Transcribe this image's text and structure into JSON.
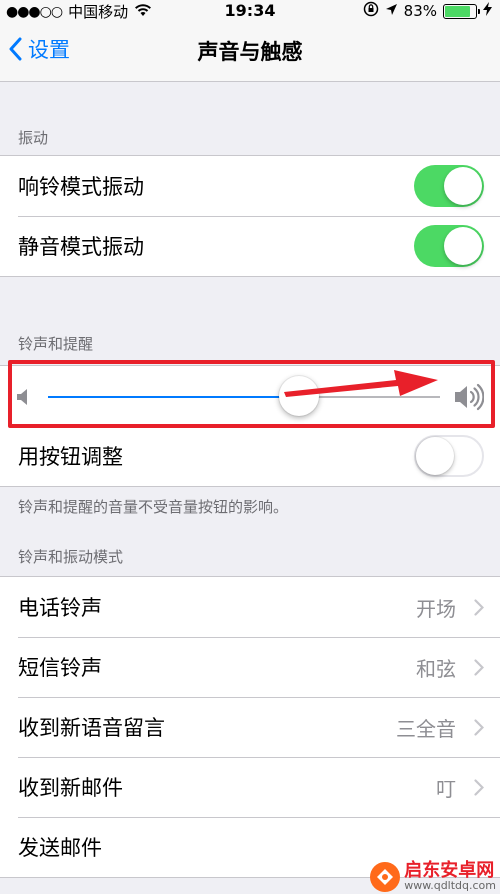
{
  "status_bar": {
    "signal": "●●●○○",
    "carrier": "中国移动",
    "time": "19:34",
    "battery_percent": "83%",
    "battery_level": 0.83
  },
  "nav": {
    "back_label": "设置",
    "title": "声音与触感"
  },
  "vibration": {
    "header": "振动",
    "rows": [
      {
        "label": "响铃模式振动",
        "on": true
      },
      {
        "label": "静音模式振动",
        "on": true
      }
    ]
  },
  "ringer": {
    "header": "铃声和提醒",
    "volume_level": 0.64,
    "button_adjust_label": "用按钮调整",
    "button_adjust_on": false,
    "footer": "铃声和提醒的音量不受音量按钮的影响。"
  },
  "patterns": {
    "header": "铃声和振动模式",
    "rows": [
      {
        "label": "电话铃声",
        "value": "开场"
      },
      {
        "label": "短信铃声",
        "value": "和弦"
      },
      {
        "label": "收到新语音留言",
        "value": "三全音"
      },
      {
        "label": "收到新邮件",
        "value": "叮"
      },
      {
        "label": "发送邮件",
        "value": ""
      }
    ]
  },
  "watermark": {
    "name": "启东安卓网",
    "url": "www.qdltdq.com"
  },
  "colors": {
    "accent": "#007aff",
    "toggle_on": "#4cd964",
    "highlight": "#e8202a"
  }
}
